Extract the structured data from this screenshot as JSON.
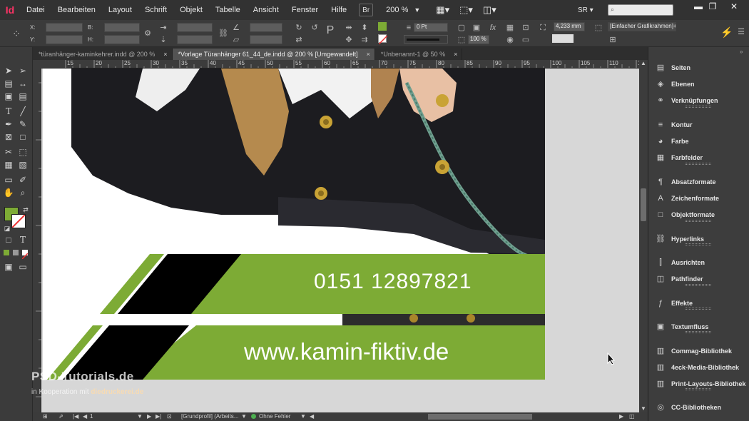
{
  "app": {
    "logo": "Id"
  },
  "menus": [
    "Datei",
    "Bearbeiten",
    "Layout",
    "Schrift",
    "Objekt",
    "Tabelle",
    "Ansicht",
    "Fenster",
    "Hilfe"
  ],
  "toolbar": {
    "bridge_label": "Br",
    "zoom_value": "200 %",
    "workspace_label": "SR",
    "search_placeholder": ""
  },
  "window_controls": {
    "minimize": "▬",
    "maximize": "❐",
    "close": "✕"
  },
  "control_panel": {
    "x_label": "X:",
    "y_label": "Y:",
    "w_label": "B:",
    "h_label": "H:",
    "stroke_weight": "0 Pt",
    "opacity": "100 %",
    "dimension": "4,233 mm",
    "frame_style": "[Einfacher Grafikrahmen]+"
  },
  "tabs": [
    {
      "label": "*türanhänger-kaminkehrer.indd @ 200 %",
      "active": false,
      "close": "×"
    },
    {
      "label": "*Vorlage Türanhänger 61_44_de.indd @ 200 % [Umgewandelt]",
      "active": true,
      "close": "×"
    },
    {
      "label": "*Unbenannt-1 @ 50 %",
      "active": false,
      "close": "×"
    }
  ],
  "ruler_marks": [
    "15",
    "20",
    "25",
    "30",
    "35",
    "40",
    "45",
    "50",
    "55",
    "60",
    "65",
    "70",
    "75",
    "80",
    "85",
    "90",
    "95",
    "100",
    "105",
    "110",
    "115"
  ],
  "document": {
    "phone": "0151 12897821",
    "website": "www.kamin-fiktiv.de",
    "brand_green": "#7dab35"
  },
  "panels": [
    {
      "label": "Seiten",
      "icon": "pages-icon",
      "glyph": "▤"
    },
    {
      "label": "Ebenen",
      "icon": "layers-icon",
      "glyph": "◈"
    },
    {
      "label": "Verknüpfungen",
      "icon": "links-icon",
      "glyph": "⚭"
    },
    {
      "label": "Kontur",
      "icon": "stroke-icon",
      "glyph": "≡"
    },
    {
      "label": "Farbe",
      "icon": "color-icon",
      "glyph": "◕"
    },
    {
      "label": "Farbfelder",
      "icon": "swatches-icon",
      "glyph": "▦"
    },
    {
      "label": "Absatzformate",
      "icon": "paragraph-styles-icon",
      "glyph": "¶"
    },
    {
      "label": "Zeichenformate",
      "icon": "character-styles-icon",
      "glyph": "A"
    },
    {
      "label": "Objektformate",
      "icon": "object-styles-icon",
      "glyph": "□"
    },
    {
      "label": "Hyperlinks",
      "icon": "hyperlinks-icon",
      "glyph": "⛓"
    },
    {
      "label": "Ausrichten",
      "icon": "align-icon",
      "glyph": "⫿"
    },
    {
      "label": "Pathfinder",
      "icon": "pathfinder-icon",
      "glyph": "◫"
    },
    {
      "label": "Effekte",
      "icon": "effects-icon",
      "glyph": "ƒ"
    },
    {
      "label": "Textumfluss",
      "icon": "text-wrap-icon",
      "glyph": "▣"
    },
    {
      "label": "Commag-Bibliothek",
      "icon": "library-icon",
      "glyph": "▥"
    },
    {
      "label": "4eck-Media-Bibliothek",
      "icon": "library-icon",
      "glyph": "▥"
    },
    {
      "label": "Print-Layouts-Bibliothek",
      "icon": "library-icon",
      "glyph": "▥"
    },
    {
      "label": "CC-Bibliotheken",
      "icon": "cc-libraries-icon",
      "glyph": "◎"
    }
  ],
  "status": {
    "page": "1",
    "profile": "[Grundprofil] (Arbeits...",
    "preflight": "Ohne Fehler"
  },
  "watermark": {
    "line1": "PSD-Tutorials.de",
    "line2": "in Kooperation mit ",
    "line2b": "diedruckerei.de"
  }
}
